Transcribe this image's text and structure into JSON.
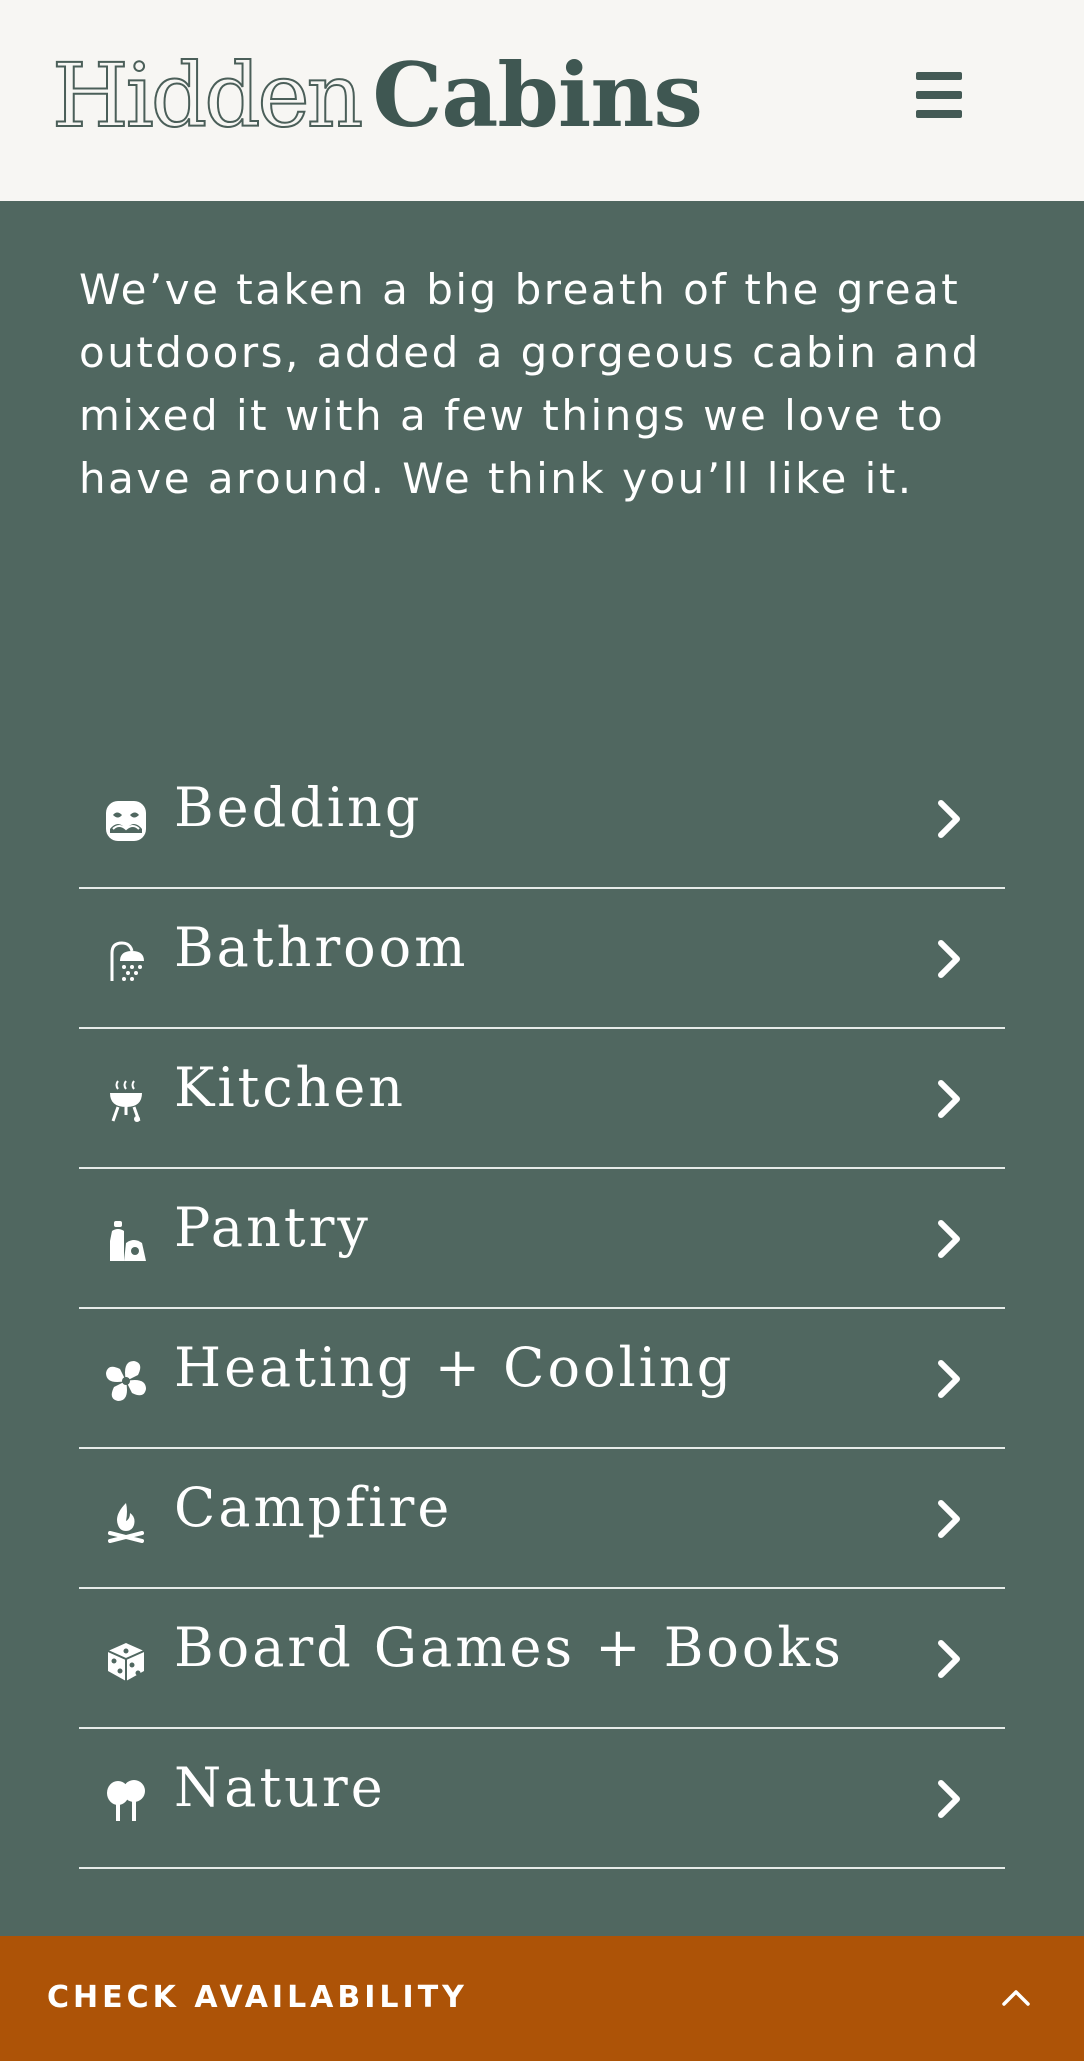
{
  "header": {
    "logo_light": "Hidden",
    "logo_bold": "Cabins",
    "menu_icon": "hamburger-menu-icon"
  },
  "intro": {
    "text": "We’ve taken a big breath of the great outdoors, added a gorgeous cabin and mixed it with a few things we love to have around. We think you’ll like it."
  },
  "amenities": [
    {
      "label": "Bedding",
      "icon": "bedding-icon"
    },
    {
      "label": "Bathroom",
      "icon": "shower-icon"
    },
    {
      "label": "Kitchen",
      "icon": "grill-icon"
    },
    {
      "label": "Pantry",
      "icon": "condiments-icon"
    },
    {
      "label": "Heating + Cooling",
      "icon": "fan-icon"
    },
    {
      "label": "Campfire",
      "icon": "campfire-icon"
    },
    {
      "label": "Board Games + Books",
      "icon": "dice-icon"
    },
    {
      "label": "Nature",
      "icon": "trees-icon"
    }
  ],
  "cta": {
    "label": "CHECK AVAILABILITY",
    "icon": "chevron-up-icon"
  },
  "colors": {
    "header_bg": "#f7f6f3",
    "page_bg": "#506760",
    "logo": "#3f5752",
    "cta_bg": "#ad5307",
    "text": "#ffffff"
  }
}
